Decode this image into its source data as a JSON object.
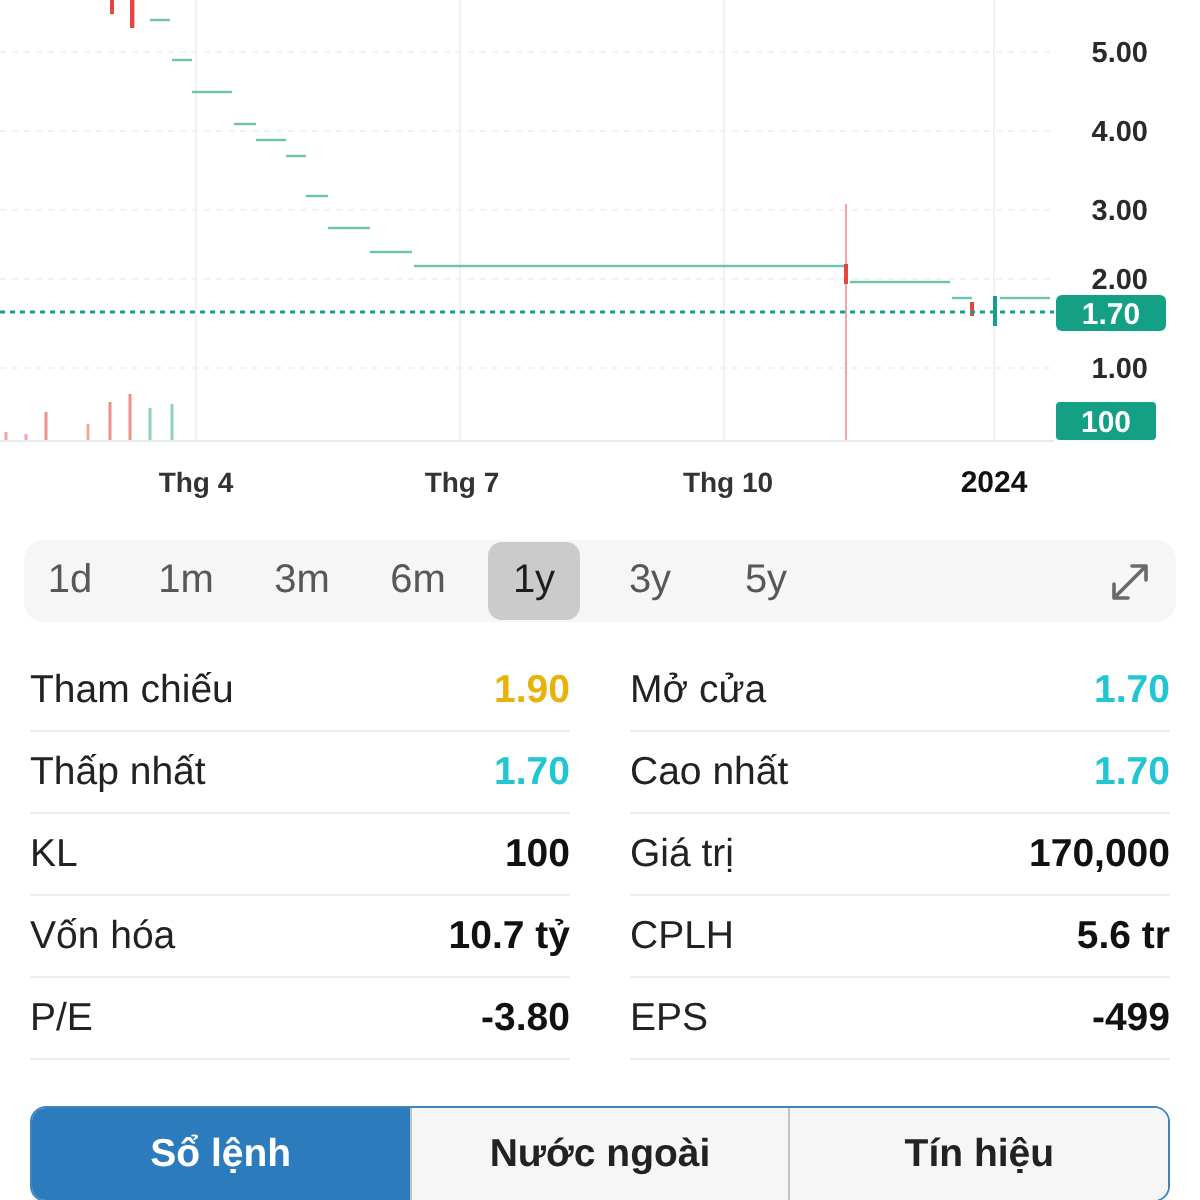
{
  "chart": {
    "y_labels": [
      "5.00",
      "4.00",
      "3.00",
      "2.00",
      "1.00"
    ],
    "last_price": "1.70",
    "volume": "100",
    "x_labels": [
      {
        "label": "Thg 4",
        "kind": "month"
      },
      {
        "label": "Thg 7",
        "kind": "month"
      },
      {
        "label": "Thg 10",
        "kind": "month"
      },
      {
        "label": "2024",
        "kind": "year"
      }
    ]
  },
  "ranges": [
    {
      "label": "1d",
      "selected": false
    },
    {
      "label": "1m",
      "selected": false
    },
    {
      "label": "3m",
      "selected": false
    },
    {
      "label": "6m",
      "selected": false
    },
    {
      "label": "1y",
      "selected": true
    },
    {
      "label": "3y",
      "selected": false
    },
    {
      "label": "5y",
      "selected": false
    }
  ],
  "stats": [
    {
      "label": "Tham chiếu",
      "value": "1.90",
      "color": "#e8b10c"
    },
    {
      "label": "Mở cửa",
      "value": "1.70",
      "color": "#22c6d3"
    },
    {
      "label": "Thấp nhất",
      "value": "1.70",
      "color": "#22c6d3"
    },
    {
      "label": "Cao nhất",
      "value": "1.70",
      "color": "#22c6d3"
    },
    {
      "label": "KL",
      "value": "100"
    },
    {
      "label": "Giá trị",
      "value": "170,000"
    },
    {
      "label": "Vốn hóa",
      "value": "10.7 tỷ"
    },
    {
      "label": "CPLH",
      "value": "5.6 tr"
    },
    {
      "label": "P/E",
      "value": "-3.80"
    },
    {
      "label": "EPS",
      "value": "-499"
    }
  ],
  "tabs": [
    {
      "label": "Sổ lệnh",
      "selected": true
    },
    {
      "label": "Nước ngoài",
      "selected": false
    },
    {
      "label": "Tín hiệu",
      "selected": false
    }
  ]
}
